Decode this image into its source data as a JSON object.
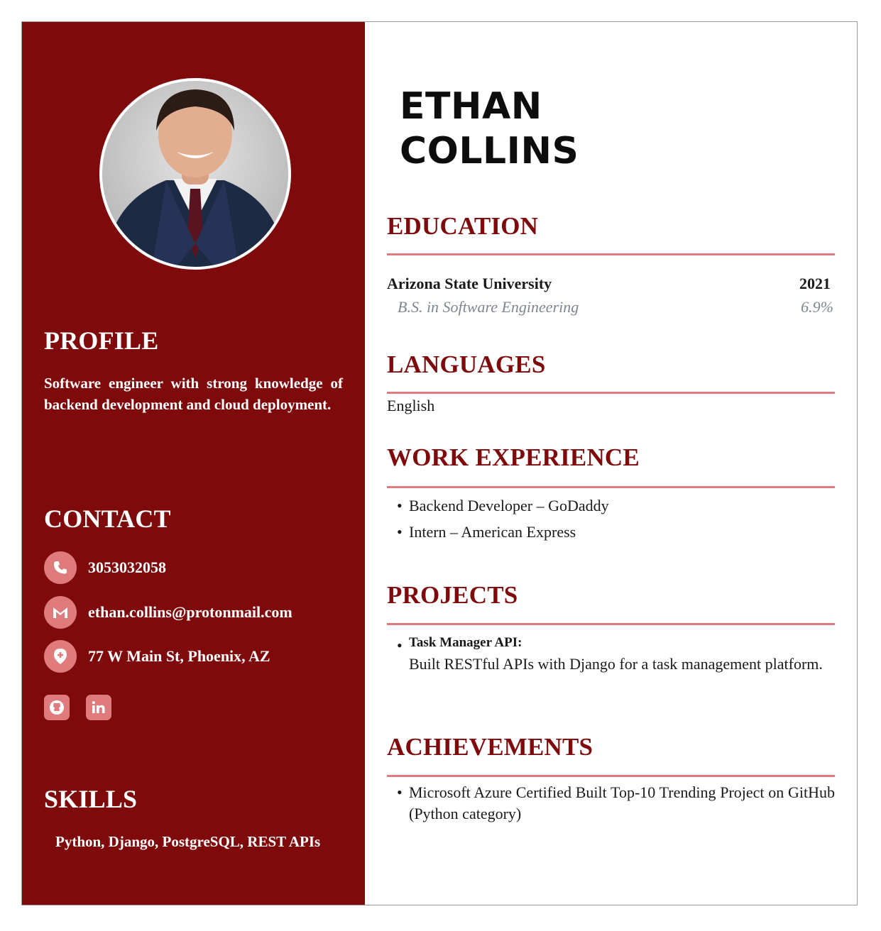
{
  "profile": {
    "heading": "PROFILE",
    "text": "Software engineer with strong knowledge of backend development and cloud deployment."
  },
  "contact": {
    "heading": "CONTACT",
    "phone": "3053032058",
    "email": "ethan.collins@protonmail.com",
    "address": "77 W Main St, Phoenix, AZ",
    "social": [
      "github-icon",
      "linkedin-icon"
    ]
  },
  "skills": {
    "heading": "SKILLS",
    "text": "Python, Django, PostgreSQL, REST APIs"
  },
  "name": {
    "first": "ETHAN",
    "last": "COLLINS"
  },
  "education": {
    "heading": "EDUCATION",
    "school": "Arizona State University",
    "year": "2021",
    "degree": "B.S. in Software Engineering",
    "gpa": "6.9%"
  },
  "languages": {
    "heading": "LANGUAGES",
    "items": [
      "English"
    ]
  },
  "work": {
    "heading": "WORK EXPERIENCE",
    "items": [
      "Backend Developer – GoDaddy",
      "Intern – American Express"
    ]
  },
  "projects": {
    "heading": "PROJECTS",
    "items": [
      {
        "title": "Task Manager API:",
        "description": "Built RESTful APIs with Django for a task management platform."
      }
    ]
  },
  "achievements": {
    "heading": "ACHIEVEMENTS",
    "items": [
      "Microsoft Azure Certified Built Top-10 Trending Project on GitHub (Python category)"
    ]
  },
  "colors": {
    "sidebar": "#7e0a0c",
    "accent": "#e07b7d",
    "heading": "#7e0a0c"
  }
}
